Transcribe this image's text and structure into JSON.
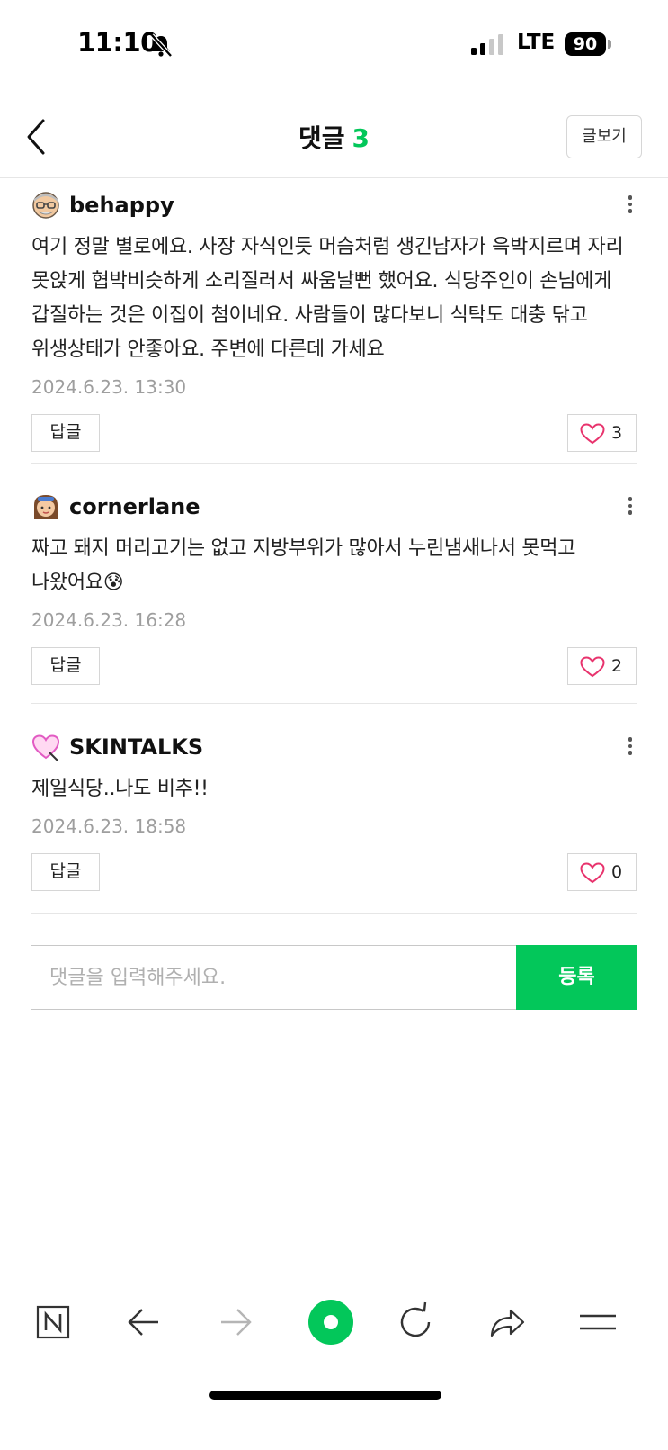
{
  "status_bar": {
    "time": "11:10",
    "network": "LTE",
    "battery": "90",
    "icons": [
      "bell-slash-icon",
      "cellular-signal-icon",
      "battery-icon"
    ]
  },
  "header": {
    "title": "댓글",
    "count": "3",
    "view_post_label": "글보기",
    "back_icon": "chevron-left-icon",
    "accent_color": "#03c75a"
  },
  "comments": [
    {
      "author": "behappy",
      "avatar": "grandpa-avatar-icon",
      "body": "여기 정말 별로에요. 사장 자식인듯 머슴처럼 생긴남자가 윽박지르며 자리 못앉게 협박비슷하게 소리질러서 싸움날뻔 했어요. 식당주인이 손님에게 갑질하는 것은 이집이 첨이네요. 사람들이 많다보니 식탁도 대충 닦고 위생상태가 안좋아요. 주변에 다른데 가세요",
      "date": "2024.6.23. 13:30",
      "reply_label": "답글",
      "likes": "3"
    },
    {
      "author": "cornerlane",
      "avatar": "girl-avatar-icon",
      "body": "짜고 돼지 머리고기는 없고 지방부위가 많아서 누린냄새나서 못먹고 나왔어요😰",
      "date": "2024.6.23. 16:28",
      "reply_label": "답글",
      "likes": "2"
    },
    {
      "author": "SKINTALKS",
      "avatar": "heart-avatar-icon",
      "body": "제일식당..나도 비추!!",
      "date": "2024.6.23. 18:58",
      "reply_label": "답글",
      "likes": "0"
    }
  ],
  "comment_form": {
    "placeholder": "댓글을 입력해주세요.",
    "submit_label": "등록"
  },
  "toolbar": {
    "items": [
      "naver-home-icon",
      "back-arrow-icon",
      "forward-arrow-icon",
      "green-dot-icon",
      "refresh-icon",
      "share-icon",
      "menu-icon"
    ]
  }
}
